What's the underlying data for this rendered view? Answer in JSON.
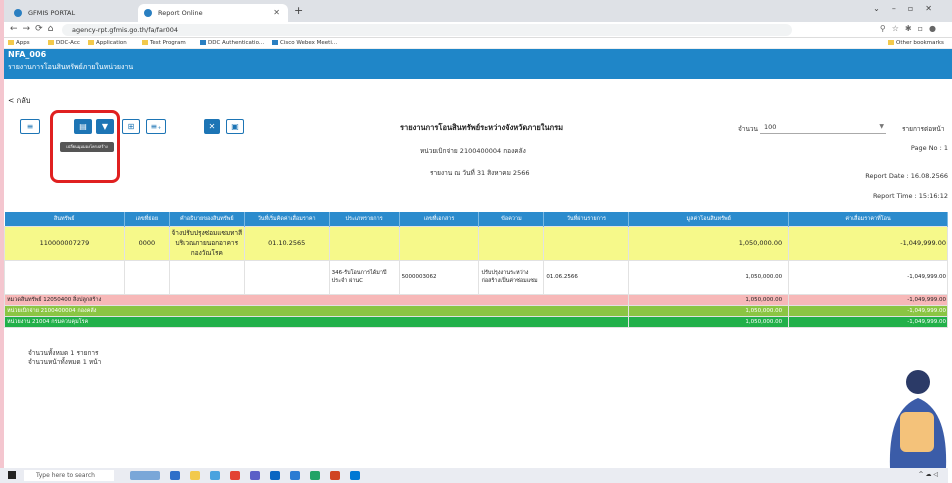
{
  "browser": {
    "tabs": [
      {
        "label": "GFMIS PORTAL"
      },
      {
        "label": "Report Online"
      }
    ],
    "url": "agency-rpt.gfmis.go.th/fa/far004",
    "bookmarks": [
      "Apps",
      "DDC-Acc",
      "Application",
      "Test Program",
      "DDC Authenticatio...",
      "Cisco Webex Meeti...",
      "Other bookmarks"
    ]
  },
  "header": {
    "code": "NFA_006",
    "subtitle": "รายงานการโอนสินทรัพย์ภายในหน่วยงาน"
  },
  "back_label": "< กลับ",
  "tooltip": "เปลี่ยนมุมมองโครงสร้าง",
  "report": {
    "title": "รายงานการโอนสินทรัพย์ระหว่างจังหวัดภายในกรม",
    "unit": "หน่วยเบิกจ่าย 2100400004 กองคลัง",
    "as_of": "รายงาน ณ วันที่ 31 สิงหาคม 2566",
    "count_label": "จำนวน",
    "count_value": "100",
    "per_page": "รายการต่อหน้า",
    "page_no": "Page No : 1",
    "report_date": "Report Date : 16.08.2566",
    "report_time": "Report Time : 15:16:12"
  },
  "table": {
    "headers": [
      "สินทรัพย์",
      "เลขที่ย่อย",
      "คำอธิบายของสินทรัพย์",
      "วันที่เริ่มคิดค่าเสื่อมราคา",
      "ประเภทรายการ",
      "เลขที่เอกสาร",
      "ข้อความ",
      "วันที่ผ่านรายการ",
      "มูลค่าโอนสินทรัพย์",
      "ค่าเสื่อมราคาที่โอน"
    ],
    "row1": [
      "110000007279",
      "0000",
      "จ้างปรับปรุงซ่อมแซมทาสีบริเวณภายนอกอาคารกองวัณโรค",
      "01.10.2565",
      "",
      "",
      "",
      "",
      "1,050,000.00",
      "-1,049,999.00"
    ],
    "row2": [
      "",
      "",
      "",
      "",
      "346-รับโอนการได้มาปีประจำ ผ่านC",
      "5000003062",
      "ปรับปรุงงานระหว่างก่อสร้างเป็นค่าซ่อมแซม",
      "01.06.2566",
      "1,050,000.00",
      "-1,049,999.00"
    ],
    "sub1": {
      "label": "หมวดสินทรัพย์ 12050400 สิ่งปลูกสร้าง",
      "value": "1,050,000.00",
      "dep": "-1,049,999.00"
    },
    "sub2": {
      "label": "หน่วยเบิกจ่าย 2100400004 กองคลัง",
      "value": "1,050,000.00",
      "dep": "-1,049,999.00"
    },
    "sub3": {
      "label": "หน่วยงาน 21004 กรมควบคุมโรค",
      "value": "1,050,000.00",
      "dep": "-1,049,999.00"
    }
  },
  "footer": {
    "total_items": "จำนวนทั้งหมด 1 รายการ",
    "total_pages": "จำนวนหน้าทั้งหมด 1 หน้า"
  },
  "taskbar": {
    "search_placeholder": "Type here to search"
  }
}
